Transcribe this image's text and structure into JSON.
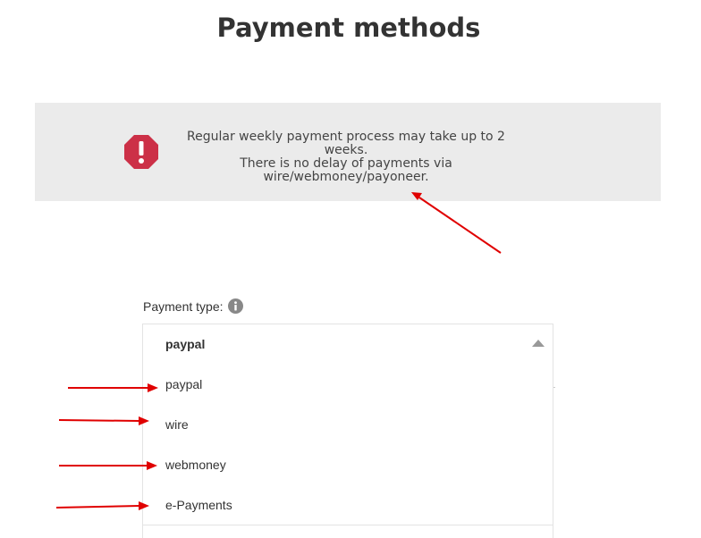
{
  "page": {
    "title": "Payment methods"
  },
  "notice": {
    "icon": "exclamation-octagon-icon",
    "icon_color": "#cc3047",
    "lines": [
      "Regular weekly payment process may take up to 2",
      "weeks.",
      "There is no delay of payments via",
      "wire/webmoney/payoneer."
    ]
  },
  "payment_type": {
    "label": "Payment type:",
    "info_icon": "info-icon",
    "selected": "paypal",
    "options": [
      "paypal",
      "wire",
      "webmoney",
      "e-Payments"
    ]
  },
  "annotation_color": "#e00000"
}
